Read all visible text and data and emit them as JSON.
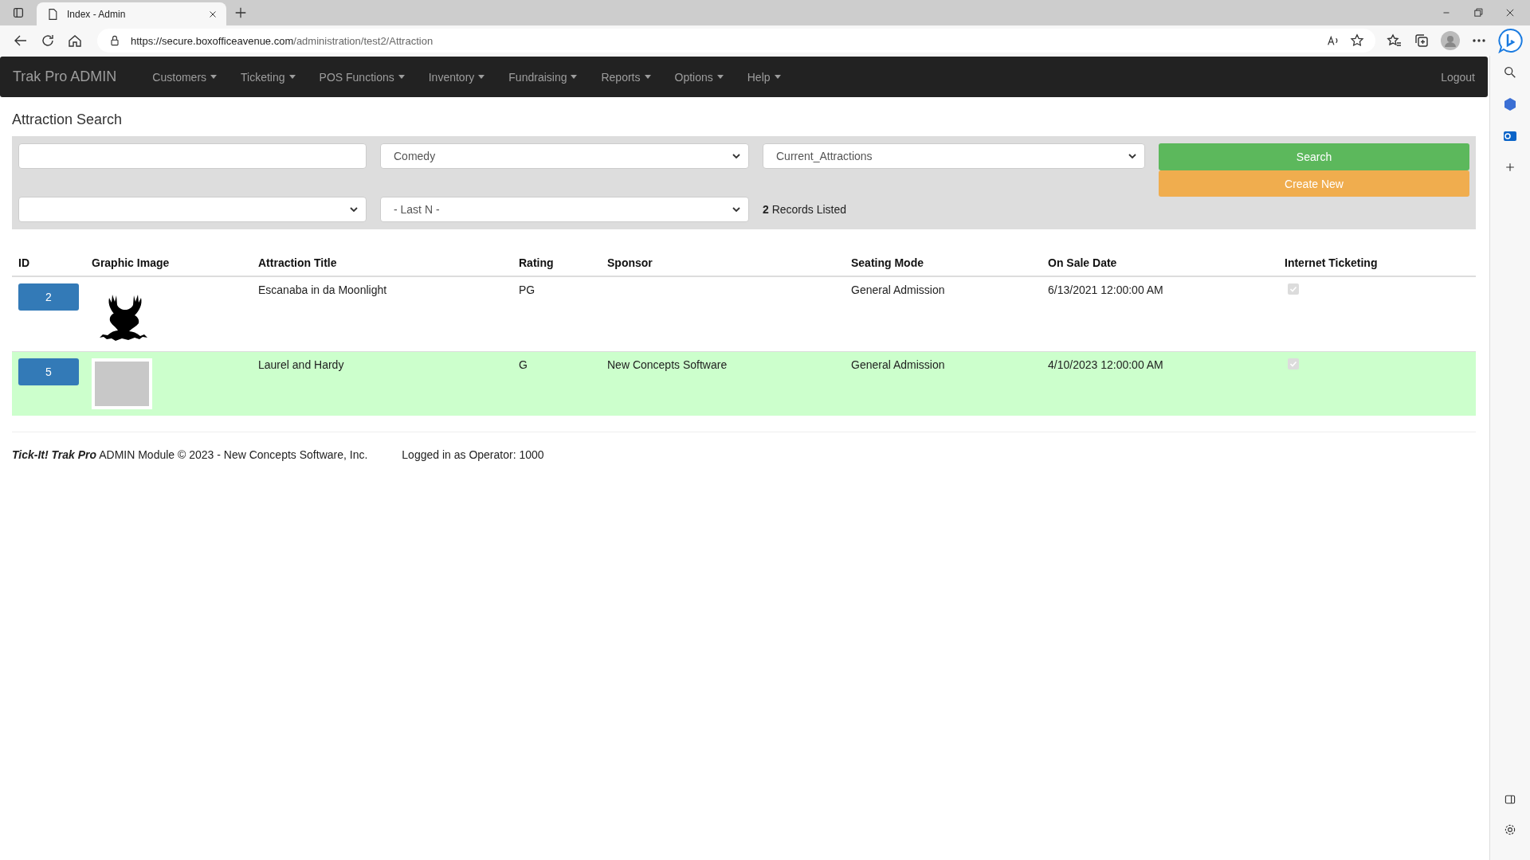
{
  "browser": {
    "tab_title": "Index - Admin",
    "url_host": "https://secure.boxofficeavenue.com",
    "url_path": "/administration/test2/Attraction"
  },
  "navbar": {
    "brand": "Trak Pro ADMIN",
    "menus": [
      "Customers",
      "Ticketing",
      "POS Functions",
      "Inventory",
      "Fundraising",
      "Reports",
      "Options",
      "Help"
    ],
    "logout": "Logout"
  },
  "page_title": "Attraction Search",
  "filters": {
    "category": "Comedy",
    "status": "Current_Attractions",
    "last_n": "- Last N -",
    "search_button": "Search",
    "create_button": "Create New",
    "records": "**2** Records Listed"
  },
  "table": {
    "columns": [
      "ID",
      "Graphic Image",
      "Attraction Title",
      "Rating",
      "Sponsor",
      "Seating Mode",
      "On Sale Date",
      "Internet Ticketing"
    ],
    "rows": [
      {
        "id": "2",
        "kind": "deer",
        "title": "Escanaba in da Moonlight",
        "rating": "PG",
        "sponsor": "",
        "seating": "General Admission",
        "on_sale": "6/13/2021 12:00:00 AM",
        "internet": true,
        "selected": false
      },
      {
        "id": "5",
        "kind": "photo",
        "title": "Laurel and Hardy",
        "rating": "G",
        "sponsor": "New Concepts Software",
        "seating": "General Admission",
        "on_sale": "4/10/2023 12:00:00 AM",
        "internet": true,
        "selected": true
      }
    ]
  },
  "footer": {
    "copyright": "**Tick-It! Trak Pro** ADMIN Module © 2023 - New Concepts Software, Inc.",
    "operator": "Logged in as Operator: 1000"
  }
}
